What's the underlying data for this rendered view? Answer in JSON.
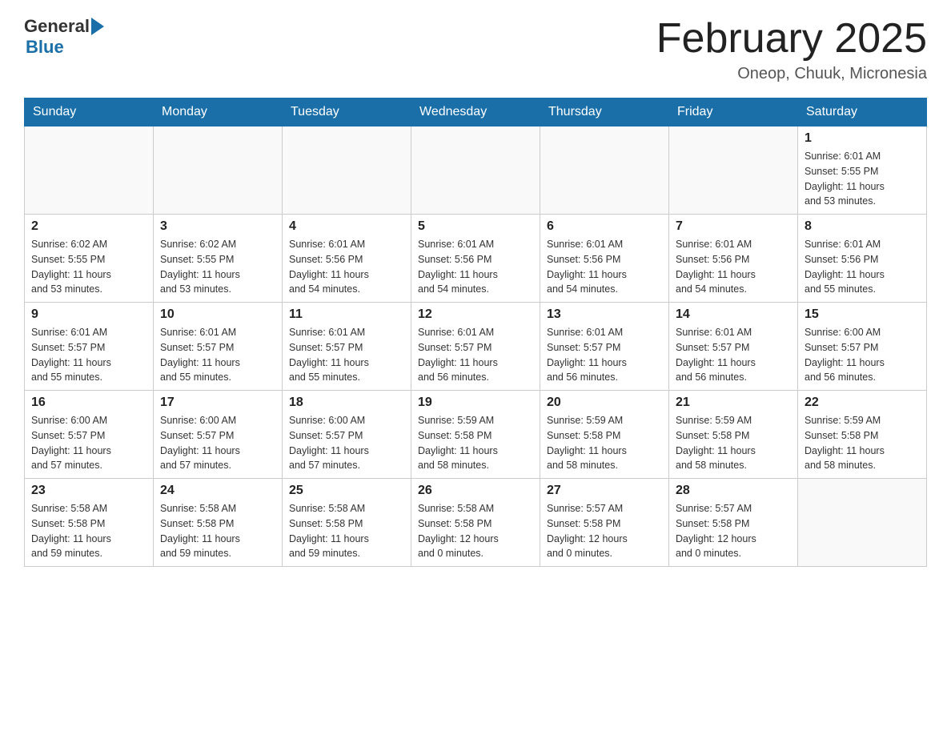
{
  "header": {
    "logo": {
      "general": "General",
      "blue": "Blue",
      "arrow_color": "#1a6fa8"
    },
    "title": "February 2025",
    "location": "Oneop, Chuuk, Micronesia"
  },
  "weekdays": [
    "Sunday",
    "Monday",
    "Tuesday",
    "Wednesday",
    "Thursday",
    "Friday",
    "Saturday"
  ],
  "weeks": [
    [
      {
        "day": "",
        "info": ""
      },
      {
        "day": "",
        "info": ""
      },
      {
        "day": "",
        "info": ""
      },
      {
        "day": "",
        "info": ""
      },
      {
        "day": "",
        "info": ""
      },
      {
        "day": "",
        "info": ""
      },
      {
        "day": "1",
        "info": "Sunrise: 6:01 AM\nSunset: 5:55 PM\nDaylight: 11 hours\nand 53 minutes."
      }
    ],
    [
      {
        "day": "2",
        "info": "Sunrise: 6:02 AM\nSunset: 5:55 PM\nDaylight: 11 hours\nand 53 minutes."
      },
      {
        "day": "3",
        "info": "Sunrise: 6:02 AM\nSunset: 5:55 PM\nDaylight: 11 hours\nand 53 minutes."
      },
      {
        "day": "4",
        "info": "Sunrise: 6:01 AM\nSunset: 5:56 PM\nDaylight: 11 hours\nand 54 minutes."
      },
      {
        "day": "5",
        "info": "Sunrise: 6:01 AM\nSunset: 5:56 PM\nDaylight: 11 hours\nand 54 minutes."
      },
      {
        "day": "6",
        "info": "Sunrise: 6:01 AM\nSunset: 5:56 PM\nDaylight: 11 hours\nand 54 minutes."
      },
      {
        "day": "7",
        "info": "Sunrise: 6:01 AM\nSunset: 5:56 PM\nDaylight: 11 hours\nand 54 minutes."
      },
      {
        "day": "8",
        "info": "Sunrise: 6:01 AM\nSunset: 5:56 PM\nDaylight: 11 hours\nand 55 minutes."
      }
    ],
    [
      {
        "day": "9",
        "info": "Sunrise: 6:01 AM\nSunset: 5:57 PM\nDaylight: 11 hours\nand 55 minutes."
      },
      {
        "day": "10",
        "info": "Sunrise: 6:01 AM\nSunset: 5:57 PM\nDaylight: 11 hours\nand 55 minutes."
      },
      {
        "day": "11",
        "info": "Sunrise: 6:01 AM\nSunset: 5:57 PM\nDaylight: 11 hours\nand 55 minutes."
      },
      {
        "day": "12",
        "info": "Sunrise: 6:01 AM\nSunset: 5:57 PM\nDaylight: 11 hours\nand 56 minutes."
      },
      {
        "day": "13",
        "info": "Sunrise: 6:01 AM\nSunset: 5:57 PM\nDaylight: 11 hours\nand 56 minutes."
      },
      {
        "day": "14",
        "info": "Sunrise: 6:01 AM\nSunset: 5:57 PM\nDaylight: 11 hours\nand 56 minutes."
      },
      {
        "day": "15",
        "info": "Sunrise: 6:00 AM\nSunset: 5:57 PM\nDaylight: 11 hours\nand 56 minutes."
      }
    ],
    [
      {
        "day": "16",
        "info": "Sunrise: 6:00 AM\nSunset: 5:57 PM\nDaylight: 11 hours\nand 57 minutes."
      },
      {
        "day": "17",
        "info": "Sunrise: 6:00 AM\nSunset: 5:57 PM\nDaylight: 11 hours\nand 57 minutes."
      },
      {
        "day": "18",
        "info": "Sunrise: 6:00 AM\nSunset: 5:57 PM\nDaylight: 11 hours\nand 57 minutes."
      },
      {
        "day": "19",
        "info": "Sunrise: 5:59 AM\nSunset: 5:58 PM\nDaylight: 11 hours\nand 58 minutes."
      },
      {
        "day": "20",
        "info": "Sunrise: 5:59 AM\nSunset: 5:58 PM\nDaylight: 11 hours\nand 58 minutes."
      },
      {
        "day": "21",
        "info": "Sunrise: 5:59 AM\nSunset: 5:58 PM\nDaylight: 11 hours\nand 58 minutes."
      },
      {
        "day": "22",
        "info": "Sunrise: 5:59 AM\nSunset: 5:58 PM\nDaylight: 11 hours\nand 58 minutes."
      }
    ],
    [
      {
        "day": "23",
        "info": "Sunrise: 5:58 AM\nSunset: 5:58 PM\nDaylight: 11 hours\nand 59 minutes."
      },
      {
        "day": "24",
        "info": "Sunrise: 5:58 AM\nSunset: 5:58 PM\nDaylight: 11 hours\nand 59 minutes."
      },
      {
        "day": "25",
        "info": "Sunrise: 5:58 AM\nSunset: 5:58 PM\nDaylight: 11 hours\nand 59 minutes."
      },
      {
        "day": "26",
        "info": "Sunrise: 5:58 AM\nSunset: 5:58 PM\nDaylight: 12 hours\nand 0 minutes."
      },
      {
        "day": "27",
        "info": "Sunrise: 5:57 AM\nSunset: 5:58 PM\nDaylight: 12 hours\nand 0 minutes."
      },
      {
        "day": "28",
        "info": "Sunrise: 5:57 AM\nSunset: 5:58 PM\nDaylight: 12 hours\nand 0 minutes."
      },
      {
        "day": "",
        "info": ""
      }
    ]
  ]
}
